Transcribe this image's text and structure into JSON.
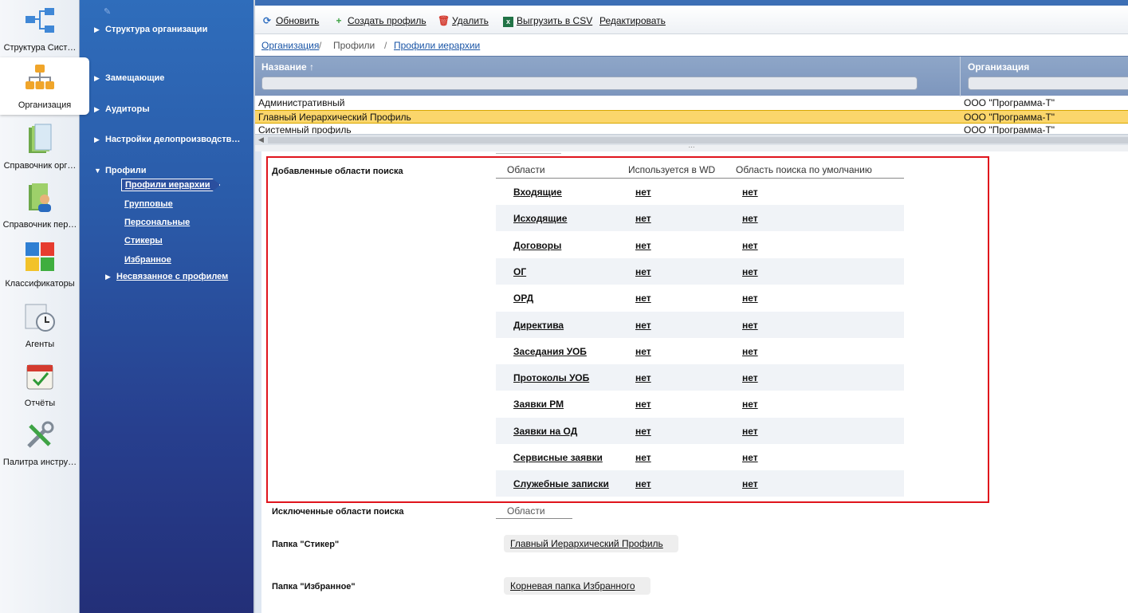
{
  "rail": {
    "items": [
      {
        "label": "Структура Сист…",
        "icon": "system-structure-icon"
      },
      {
        "label": "Организация",
        "icon": "organization-chart-icon"
      },
      {
        "label": "Справочник орг…",
        "icon": "folder-icon"
      },
      {
        "label": "Справочник пер…",
        "icon": "people-directory-icon"
      },
      {
        "label": "Классификаторы",
        "icon": "puzzle-icon"
      },
      {
        "label": "Агенты",
        "icon": "clock-agent-icon"
      },
      {
        "label": "Отчёты",
        "icon": "calendar-report-icon"
      },
      {
        "label": "Палитра инстру…",
        "icon": "tools-icon"
      }
    ]
  },
  "tree": {
    "nodes": [
      "Структура организации",
      "Замещающие",
      "Аудиторы",
      "Настройки делопроизводств…",
      "Профили"
    ],
    "profile_children": [
      "Профили иерархии",
      "Групповые",
      "Персональные",
      "Стикеры",
      "Избранное"
    ],
    "unlinked": "Несвязанное с профилем"
  },
  "toolbar": {
    "refresh": "Обновить",
    "create": "Создать профиль",
    "delete": "Удалить",
    "export": "Выгрузить в CSV",
    "edit": "Редактировать"
  },
  "breadcrumb": {
    "organization": "Организация",
    "separator": "/",
    "profiles": "Профили",
    "current": "Профили иерархии"
  },
  "grid": {
    "col_name": "Название ↑",
    "col_org": "Организация",
    "rows": [
      {
        "name": "Административный",
        "org": "ООО \"Программа-Т\""
      },
      {
        "name": "Главный Иерархический Профиль",
        "org": "ООО \"Программа-Т\""
      },
      {
        "name": "Системный профиль",
        "org": "ООО \"Программа-Т\""
      }
    ],
    "selected_row": 1,
    "splitter_handle": "···"
  },
  "details": {
    "added_label": "Добавленные области поиска",
    "cols": {
      "areas": "Области",
      "used_in_wd": "Используется в WD",
      "default_area": "Область поиска по умолчанию"
    },
    "areas": [
      {
        "name": "Входящие",
        "wd": "нет",
        "def": "нет"
      },
      {
        "name": "Исходящие",
        "wd": "нет",
        "def": "нет"
      },
      {
        "name": "Договоры",
        "wd": "нет",
        "def": "нет"
      },
      {
        "name": "ОГ",
        "wd": "нет",
        "def": "нет"
      },
      {
        "name": "ОРД",
        "wd": "нет",
        "def": "нет"
      },
      {
        "name": "Директива",
        "wd": "нет",
        "def": "нет"
      },
      {
        "name": "Заседания УОБ",
        "wd": "нет",
        "def": "нет"
      },
      {
        "name": "Протоколы УОБ",
        "wd": "нет",
        "def": "нет"
      },
      {
        "name": "Заявки РМ",
        "wd": "нет",
        "def": "нет"
      },
      {
        "name": "Заявки на ОД",
        "wd": "нет",
        "def": "нет"
      },
      {
        "name": "Сервисные заявки",
        "wd": "нет",
        "def": "нет"
      },
      {
        "name": "Служебные записки",
        "wd": "нет",
        "def": "нет"
      }
    ],
    "excluded_label": "Исключенные области поиска",
    "excluded_col": "Области",
    "sticker_label": "Папка \"Стикер\"",
    "sticker_value": "Главный Иерархический Профиль",
    "favorites_label": "Папка \"Избранное\"",
    "favorites_value": "Корневая папка Избранного"
  },
  "colors": {
    "highlight_border": "#e0141c",
    "selected_row": "#fbd66b",
    "tree_bg": "#2a5aa8",
    "grid_header": "#8ea6c8"
  }
}
